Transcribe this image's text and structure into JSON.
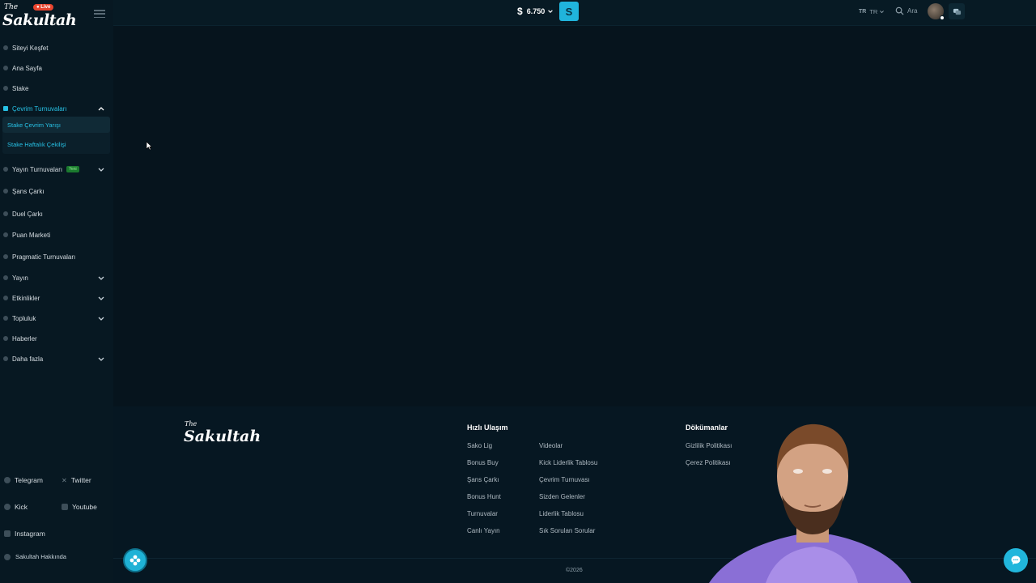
{
  "brand": {
    "logo_top": "The",
    "logo_main": "Sakultah",
    "live_badge": "● Live"
  },
  "sidebar": {
    "items": [
      {
        "label": "Siteyi Keşfet"
      },
      {
        "label": "Ana Sayfa"
      },
      {
        "label": "Stake"
      },
      {
        "label": "Çevrim Turnuvaları"
      },
      {
        "label": "Yayın Turnuvaları",
        "badge": "Yeni"
      },
      {
        "label": "Şans Çarkı"
      },
      {
        "label": "Duel Çarkı"
      },
      {
        "label": "Puan Marketi"
      },
      {
        "label": "Pragmatic Turnuvaları"
      },
      {
        "label": "Yayın"
      },
      {
        "label": "Etkinlikler"
      },
      {
        "label": "Topluluk"
      },
      {
        "label": "Haberler"
      },
      {
        "label": "Daha fazla"
      }
    ],
    "subitems": [
      {
        "label": "Stake Çevrim Yarışı"
      },
      {
        "label": "Stake Haftalık Çekilişi"
      }
    ],
    "social": {
      "telegram": "Telegram",
      "twitter": "Twitter",
      "kick": "Kick",
      "youtube": "Youtube",
      "instagram": "Instagram"
    },
    "about": "Sakultah Hakkında"
  },
  "topbar": {
    "currency_symbol": "$",
    "balance": "6.750",
    "wallet_icon": "S",
    "lang_flag": "TR",
    "lang": "TR",
    "search_label": "Ara"
  },
  "footer": {
    "logo_top": "The",
    "logo_main": "Sakultah",
    "quick_title": "Hızlı Ulaşım",
    "quick_col1": [
      "Sako Lig",
      "Bonus Buy",
      "Şans Çarkı",
      "Bonus Hunt",
      "Turnuvalar",
      "Canlı Yayın"
    ],
    "quick_col2": [
      "Videolar",
      "Kick Liderlik Tablosu",
      "Çevrim Turnuvası",
      "Sizden Gelenler",
      "Liderlik Tablosu",
      "Sık Sorulan Sorular"
    ],
    "docs_title": "Dökümanlar",
    "docs": [
      "Gizlilik Politikası",
      "Çerez Politikası"
    ],
    "copyright": "©2026"
  },
  "colors": {
    "accent": "#27c2e6",
    "background": "#06141d",
    "sidebar": "#071822"
  }
}
